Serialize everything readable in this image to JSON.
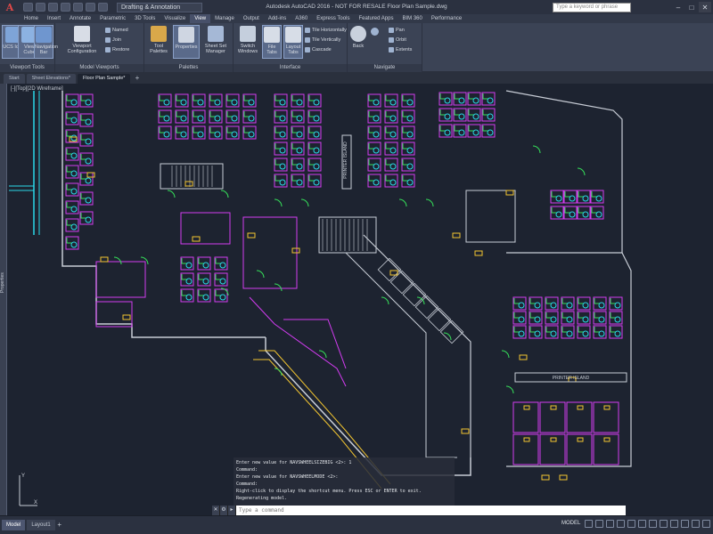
{
  "app": {
    "title": "Autodesk AutoCAD 2016 - NOT FOR RESALE   Floor Plan Sample.dwg",
    "logo": "A",
    "workspace": "Drafting & Annotation",
    "search_placeholder": "Type a keyword or phrase"
  },
  "ribbon_tabs": [
    "Home",
    "Insert",
    "Annotate",
    "Parametric",
    "3D Tools",
    "Visualize",
    "View",
    "Manage",
    "Output",
    "Add-ins",
    "A360",
    "Express Tools",
    "Featured Apps",
    "BIM 360",
    "Performance"
  ],
  "active_ribbon_tab": "View",
  "ribbon": {
    "viewport_tools": {
      "label": "Viewport Tools",
      "buttons": [
        "UCS Icon",
        "View Cube",
        "Navigation Bar"
      ]
    },
    "model_viewports": {
      "label": "Model Viewports",
      "buttons": [
        "Viewport Configuration"
      ],
      "small": [
        "Named",
        "Join",
        "Restore"
      ]
    },
    "palettes": {
      "label": "Palettes",
      "buttons": [
        "Tool Palettes",
        "Properties",
        "Sheet Set Manager"
      ]
    },
    "interface": {
      "label": "Interface",
      "buttons": [
        "Switch Windows",
        "File Tabs",
        "Layout Tabs"
      ],
      "small": [
        "Tile Horizontally",
        "Tile Vertically",
        "Cascade"
      ]
    },
    "navigate": {
      "label": "Navigate",
      "buttons": [
        "Back"
      ],
      "small": [
        "Pan",
        "Orbit",
        "Extents"
      ]
    }
  },
  "doc_tabs": [
    "Start",
    "Sheet Elevations*",
    "Floor Plan Sample*"
  ],
  "active_doc_tab": "Floor Plan Sample*",
  "side_palette_label": "Properties",
  "viewport_label": "[-][Top][2D Wireframe]",
  "drawing": {
    "printer_island_labels": [
      "PRINTER ISLAND",
      "PRINTER ISLAND"
    ],
    "colors": {
      "walls": "#c8cdd6",
      "offices": "#d23cf0",
      "furniture_green": "#36e05a",
      "chairs_cyan": "#2ad8e8",
      "tags_yellow": "#f2c531",
      "background": "#1d2330"
    }
  },
  "command_history": [
    "Enter new value for NAVSWHEELSIZEBIG <2>: 1",
    "Command:",
    "Enter new value for NAVSWHEELMODE <2>:",
    "Command:",
    "Right-click to display the shortcut menu. Press ESC or ENTER to exit.",
    "Regenerating model."
  ],
  "command_input_placeholder": "Type a command",
  "layout_tabs": [
    "Model",
    "Layout1"
  ],
  "active_layout_tab": "Model",
  "status": {
    "space": "MODEL"
  }
}
